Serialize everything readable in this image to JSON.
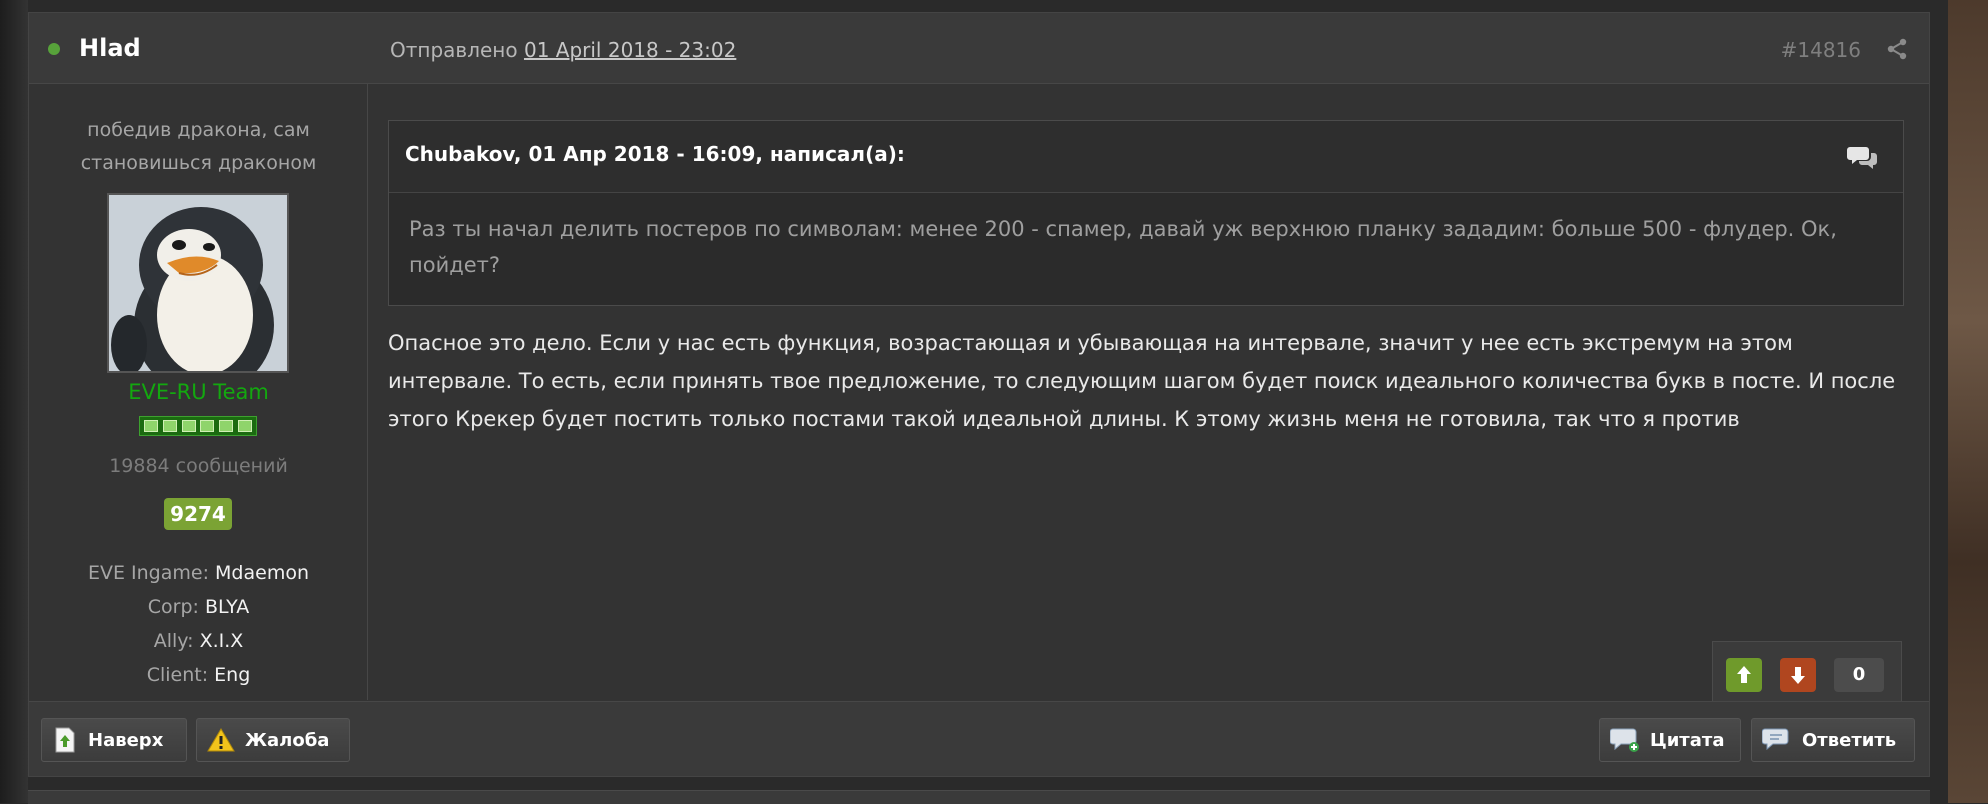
{
  "header": {
    "author": "Hlad",
    "posted_label": "Отправлено ",
    "posted_date": "01 April 2018 - 23:02",
    "post_number": "#14816"
  },
  "sidebar": {
    "user_title": "победив дракона, сам становишься драконом",
    "group": "EVE-RU Team",
    "post_count": "19884 сообщений",
    "reputation": "9274",
    "fields": [
      {
        "label": "EVE Ingame:",
        "value": "Mdaemon"
      },
      {
        "label": "Corp:",
        "value": "BLYA"
      },
      {
        "label": "Ally:",
        "value": "X.I.X"
      },
      {
        "label": "Client:",
        "value": "Eng"
      }
    ]
  },
  "quote": {
    "citation": "Chubakov, 01 Апр 2018 - 16:09, написал(а):",
    "text": "Раз ты начал делить постеров по символам: менее 200 - спамер, давай уж верхнюю планку зададим: больше 500 - флудер. Ок, пойдет?"
  },
  "post": {
    "text": "Опасное это дело. Если у нас есть функция, возрастающая и убывающая на интервале, значит у нее есть экстремум на этом интервале. То есть, если принять твое предложение, то следующим шагом будет поиск идеального количества букв в посте. И после этого Крекер будет постить только постами такой идеальной длины. К этому жизнь меня не готовила, так что я против"
  },
  "votes": {
    "count": "0"
  },
  "footer": {
    "top_label": "Наверх",
    "report_label": "Жалоба",
    "quote_label": "Цитата",
    "reply_label": "Ответить"
  },
  "colors": {
    "online": "#57a23a",
    "group": "#13a80f",
    "reputation": "#7ba334",
    "vote_up": "#6f9a2b",
    "vote_down": "#b0461f"
  }
}
